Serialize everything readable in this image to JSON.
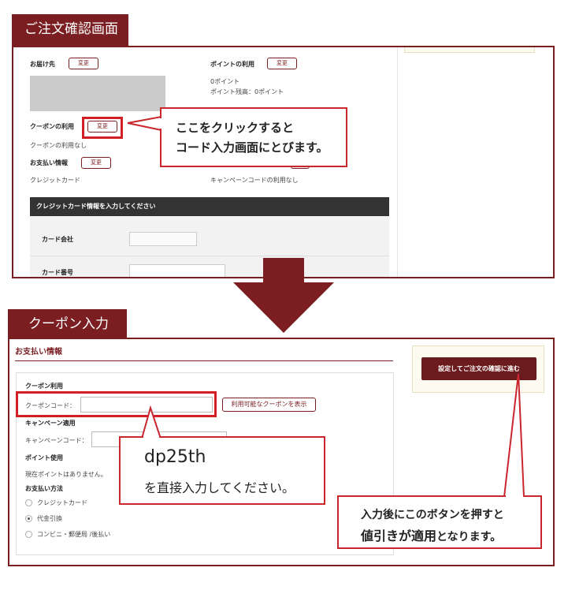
{
  "confirm": {
    "tab_title": "ご注文確認画面",
    "delivery_label": "お届け先",
    "change_label": "変更",
    "points_label": "ポイントの利用",
    "points_value": "0ポイント",
    "points_balance": "ポイント残高：0ポイント",
    "coupon_label": "クーポンの利用",
    "coupon_none": "クーポンの利用なし",
    "payment_label": "お支払い情報",
    "payment_value": "クレジットカード",
    "campaign_none": "キャンペーンコードの利用なし",
    "card_section_title": "クレジットカード情報を入力してください",
    "card_company_label": "カード会社",
    "card_number_label": "カード番号",
    "callout_line1": "ここをクリックすると",
    "callout_line2": "コード入力画面にとびます。"
  },
  "coupon": {
    "tab_title": "クーポン入力",
    "section_title": "お支払い情報",
    "coupon_use_label": "クーポン利用",
    "coupon_code_label": "クーポンコード：",
    "coupon_code_value": "",
    "show_coupons_button": "利用可能なクーポンを表示",
    "campaign_use_label": "キャンペーン適用",
    "campaign_code_label": "キャンペーンコード：",
    "point_use_label": "ポイント使用",
    "point_none": "現在ポイントはありません。",
    "pay_method_label": "お支払い方法",
    "pay_options": [
      "クレジットカード",
      "代金引換",
      "コンビニ・郵便局 /後払い"
    ],
    "pay_selected": "代金引換",
    "proceed_button": "設定してご注文の確認に進む",
    "code_callout_code": "dp25th",
    "code_callout_text": "を直接入力してください。",
    "btn_callout_line1": "入力後にこのボタンを押すと",
    "btn_callout_line2_strong": "値引きが適用",
    "btn_callout_line2_rest": "となります。"
  },
  "colors": {
    "brand": "#7a1e22",
    "highlight": "#d11f25"
  }
}
